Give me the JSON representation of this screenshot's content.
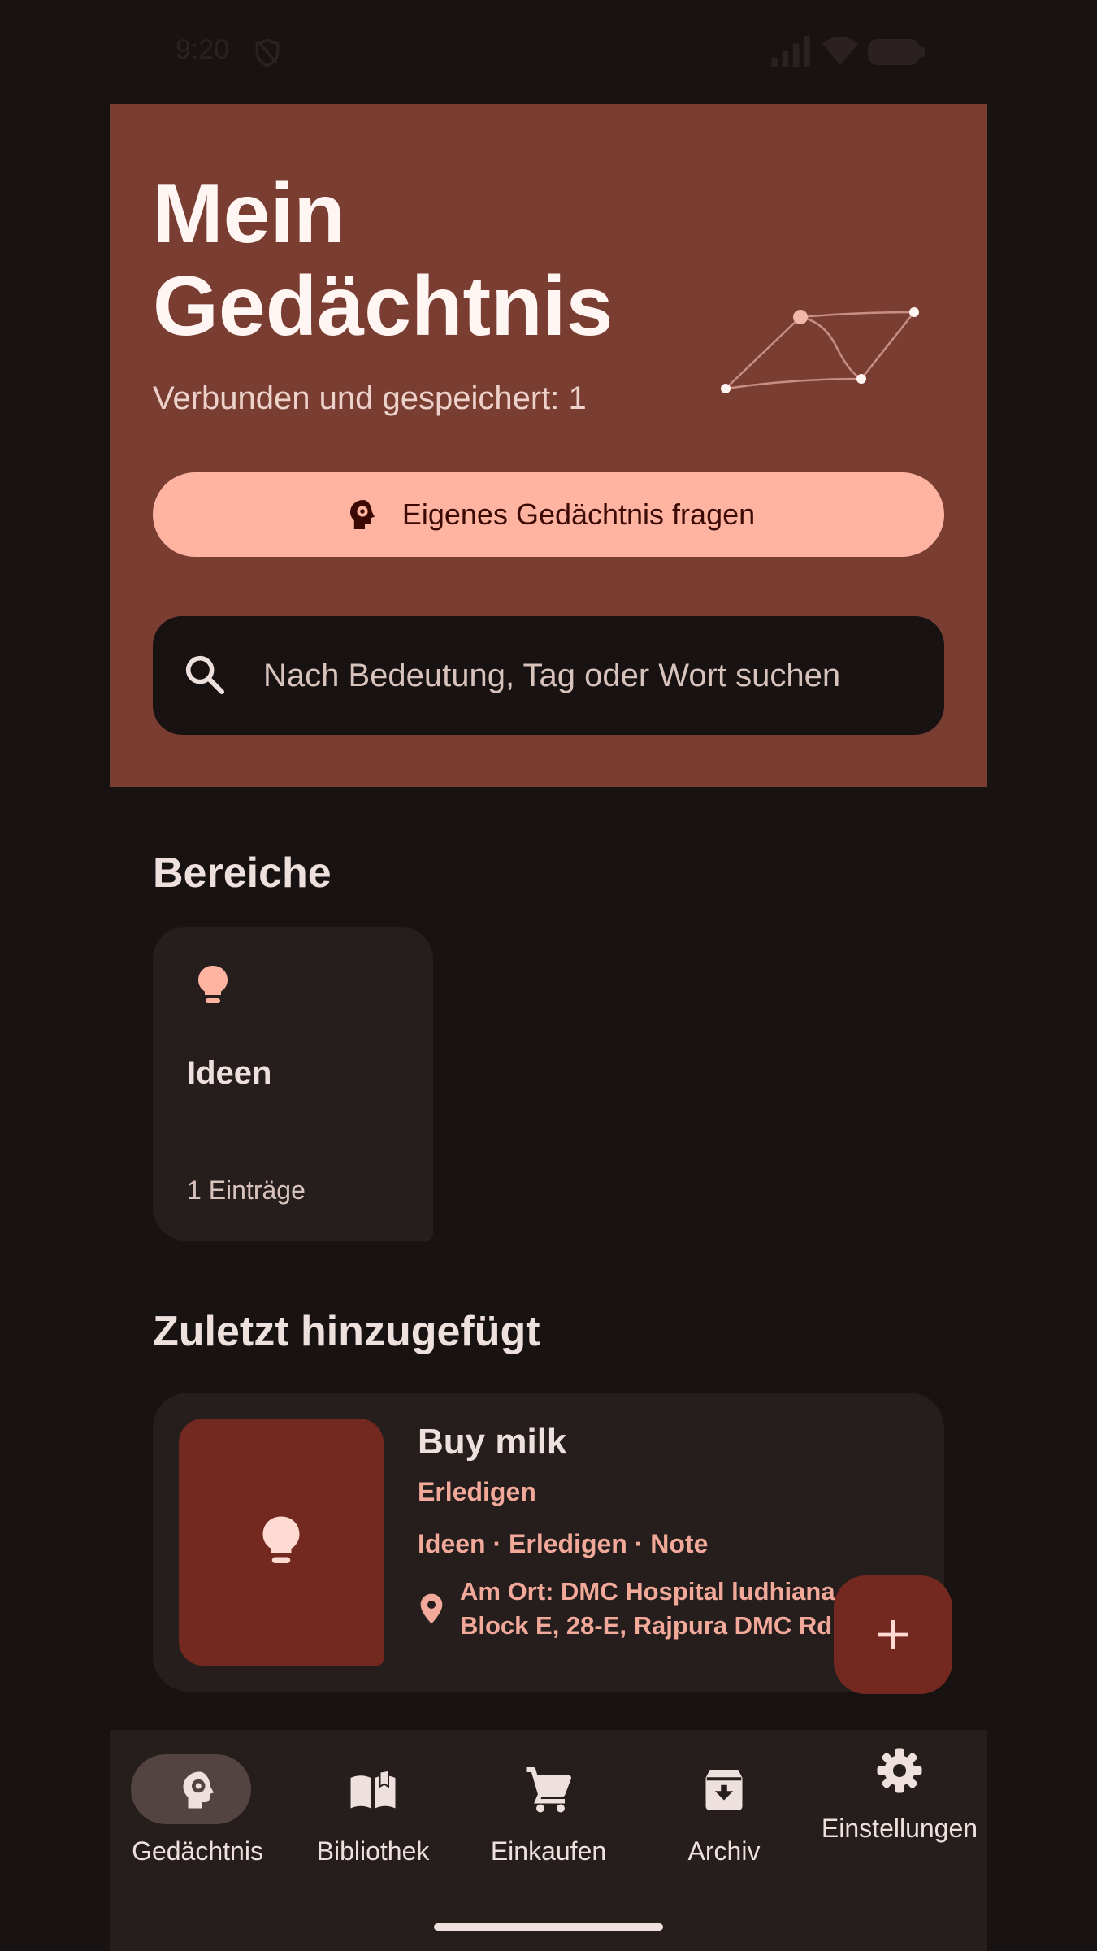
{
  "status_bar": {
    "time": "9:20"
  },
  "hero": {
    "title": "Mein Gedächtnis",
    "subtitle": "Verbunden und gespeichert: 1",
    "ask_button_label": "Eigenes Gedächtnis fragen",
    "search_placeholder": "Nach Bedeutung, Tag oder Wort suchen"
  },
  "areas": {
    "title": "Bereiche",
    "items": [
      {
        "name": "Ideen",
        "count": "1 Einträge",
        "icon": "lightbulb-icon"
      }
    ]
  },
  "recent": {
    "title": "Zuletzt hinzugefügt",
    "items": [
      {
        "title": "Buy milk",
        "status": "Erledigen",
        "tags": "Ideen · Erledigen · Note",
        "location": "Am Ort: DMC Hospital ludhiana, Block E, 28-E, Rajpura DMC Rd",
        "icon": "lightbulb-icon"
      }
    ]
  },
  "fab": {
    "icon": "plus-icon"
  },
  "nav": {
    "items": [
      {
        "label": "Gedächtnis",
        "icon": "brain-gear-icon",
        "active": true
      },
      {
        "label": "Bibliothek",
        "icon": "book-icon",
        "active": false
      },
      {
        "label": "Einkaufen",
        "icon": "cart-icon",
        "active": false
      },
      {
        "label": "Archiv",
        "icon": "archive-icon",
        "active": false
      },
      {
        "label": "Einstellungen",
        "icon": "gear-icon",
        "active": false
      }
    ]
  },
  "colors": {
    "background": "#181312",
    "hero": "#7a3d32",
    "accent": "#ffb4a2",
    "accent_text": "#f2a99a",
    "card": "#251e1d",
    "thumb": "#73291f"
  }
}
